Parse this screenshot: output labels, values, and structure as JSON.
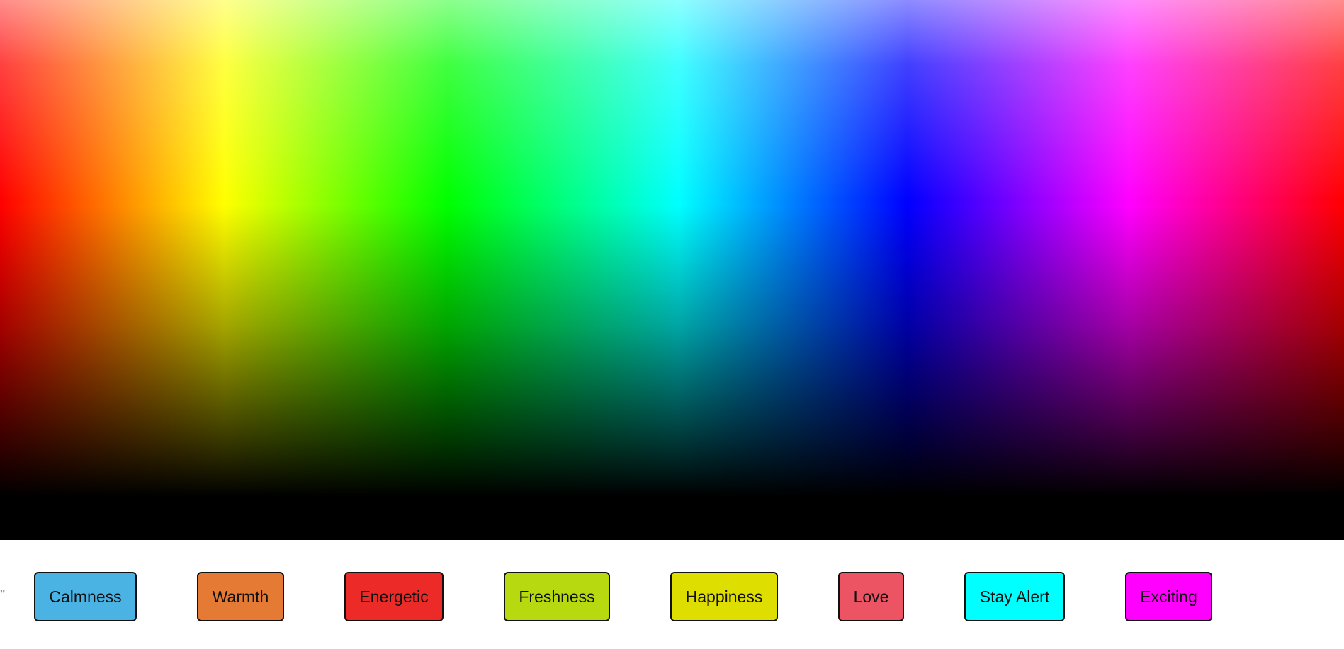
{
  "stray_text": "\"",
  "moods": [
    {
      "label": "Calmness",
      "color": "#4ab3e3"
    },
    {
      "label": "Warmth",
      "color": "#e57a35"
    },
    {
      "label": "Energetic",
      "color": "#ec2b28"
    },
    {
      "label": "Freshness",
      "color": "#b7d90f"
    },
    {
      "label": "Happiness",
      "color": "#dede00"
    },
    {
      "label": "Love",
      "color": "#ec5363"
    },
    {
      "label": "Stay Alert",
      "color": "#00ffff"
    },
    {
      "label": "Exciting",
      "color": "#ff00ff"
    }
  ]
}
